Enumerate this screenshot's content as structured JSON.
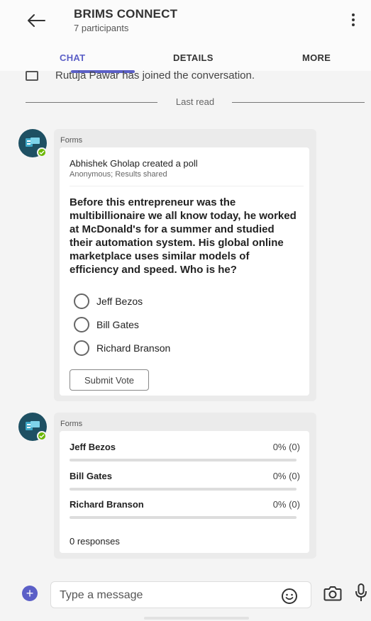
{
  "header": {
    "title": "BRIMS CONNECT",
    "subtitle": "7 participants"
  },
  "tabs": [
    {
      "label": "CHAT",
      "active": true
    },
    {
      "label": "DETAILS",
      "active": false
    },
    {
      "label": "MORE",
      "active": false
    }
  ],
  "system_message": "Rutuja Pawar has joined the conversation.",
  "last_read_label": "Last read",
  "poll": {
    "sender": "Forms",
    "creator_text": "Abhishek Gholap created a poll",
    "meta": "Anonymous; Results shared",
    "question": "Before this entrepreneur was the multibillionaire we all know today, he worked at McDonald's for a summer and studied their automation system. His global online marketplace uses similar models of efficiency and speed. Who is he?",
    "options": [
      "Jeff Bezos",
      "Bill Gates",
      "Richard Branson"
    ],
    "submit_label": "Submit Vote"
  },
  "results": {
    "sender": "Forms",
    "rows": [
      {
        "name": "Jeff Bezos",
        "value": "0% (0)",
        "percent": 0
      },
      {
        "name": "Bill Gates",
        "value": "0% (0)",
        "percent": 0
      },
      {
        "name": "Richard Branson",
        "value": "0% (0)",
        "percent": 0
      }
    ],
    "responses": "0 responses"
  },
  "compose": {
    "placeholder": "Type a message"
  },
  "colors": {
    "accent": "#5b5fc7",
    "avatar_bg": "#1e5063",
    "online_badge": "#6bb700"
  }
}
